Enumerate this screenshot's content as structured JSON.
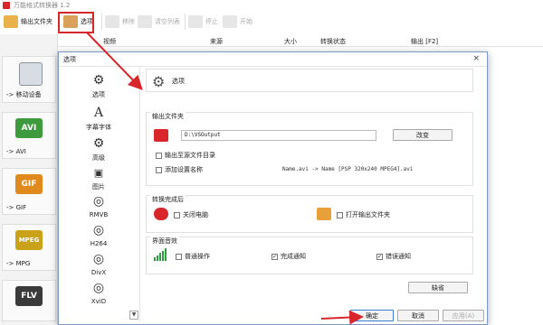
{
  "app": {
    "title": "万能格式转换器 1.2"
  },
  "toolbar": {
    "output_folder": "输出文件夹",
    "options": "选项",
    "remove": "移除",
    "clear_list": "清空列表",
    "stop": "停止",
    "start": "开始"
  },
  "list_header": {
    "video": "视频",
    "source": "来源",
    "size": "大小",
    "convert_status": "转换状态",
    "output": "输出 [F2]"
  },
  "left_panel": {
    "items": [
      {
        "label": "-> 移动设备"
      },
      {
        "label": "-> AVI",
        "badge": "AVI",
        "color": "#3d9b3d"
      },
      {
        "label": "-> GIF",
        "badge": "GIF",
        "color": "#e08a1e"
      },
      {
        "label": "-> MPG",
        "badge": "MPEG",
        "color": "#c9a21a"
      },
      {
        "label": "",
        "badge": "FLV",
        "color": "#3a3a3a"
      }
    ]
  },
  "dialog": {
    "title": "选项",
    "close": "×",
    "nav": [
      {
        "label": "选项",
        "icon": "gear-icon"
      },
      {
        "label": "字幕字体",
        "icon": "font-icon"
      },
      {
        "label": "高级",
        "icon": "advanced-gear-icon"
      },
      {
        "label": "图片",
        "icon": "picture-icon"
      },
      {
        "label": "RMVB",
        "icon": "film-reel-icon"
      },
      {
        "label": "H264",
        "icon": "film-reel-icon"
      },
      {
        "label": "DivX",
        "icon": "film-reel-icon"
      },
      {
        "label": "XviD",
        "icon": "film-reel-icon"
      }
    ],
    "header_title": "选项",
    "output_section": {
      "title": "输出文件夹",
      "path": "D:\\VSOutput",
      "change_button": "改变",
      "opt_save_to_source": "输出至源文件目录",
      "opt_add_setting_name": "添加设置名称",
      "example": "Name.avi  -> Name [PSP 320x240 MPEG4].avi"
    },
    "done_section": {
      "title": "转换完成后",
      "shutdown": "关闭电脑",
      "open_folder": "打开输出文件夹"
    },
    "ui_section": {
      "title": "界面音效",
      "normal": "普通操作",
      "done": "完成通知",
      "error": "错误通知",
      "done_checked": "✓",
      "error_checked": "✓"
    },
    "default_button": "缺省",
    "ok_button": "确定",
    "cancel_button": "取消",
    "apply_button": "应用(A)"
  }
}
